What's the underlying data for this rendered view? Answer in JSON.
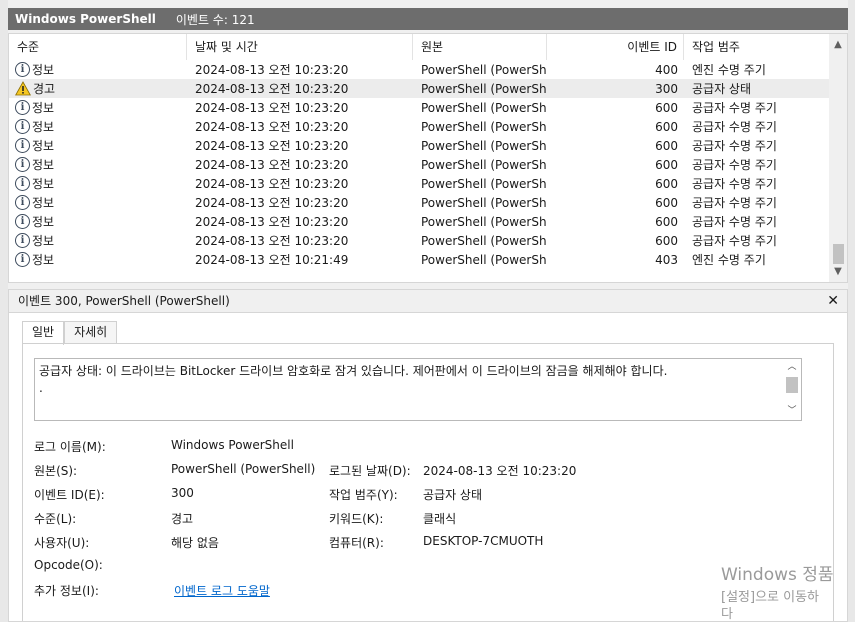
{
  "title_bar": {
    "app_name": "Windows PowerShell",
    "event_count": "이벤트 수: 121"
  },
  "columns": {
    "level": "수준",
    "datetime": "날짜 및 시간",
    "source": "원본",
    "event_id": "이벤트 ID",
    "category": "작업 범주"
  },
  "events": [
    {
      "level": "정보",
      "icon": "info-icon",
      "datetime": "2024-08-13 오전 10:23:20",
      "source": "PowerShell (PowerSh...",
      "event_id": "400",
      "category": "엔진 수명 주기"
    },
    {
      "level": "경고",
      "icon": "warning-icon",
      "datetime": "2024-08-13 오전 10:23:20",
      "source": "PowerShell (PowerSh...",
      "event_id": "300",
      "category": "공급자 상태"
    },
    {
      "level": "정보",
      "icon": "info-icon",
      "datetime": "2024-08-13 오전 10:23:20",
      "source": "PowerShell (PowerSh...",
      "event_id": "600",
      "category": "공급자 수명 주기"
    },
    {
      "level": "정보",
      "icon": "info-icon",
      "datetime": "2024-08-13 오전 10:23:20",
      "source": "PowerShell (PowerSh...",
      "event_id": "600",
      "category": "공급자 수명 주기"
    },
    {
      "level": "정보",
      "icon": "info-icon",
      "datetime": "2024-08-13 오전 10:23:20",
      "source": "PowerShell (PowerSh...",
      "event_id": "600",
      "category": "공급자 수명 주기"
    },
    {
      "level": "정보",
      "icon": "info-icon",
      "datetime": "2024-08-13 오전 10:23:20",
      "source": "PowerShell (PowerSh...",
      "event_id": "600",
      "category": "공급자 수명 주기"
    },
    {
      "level": "정보",
      "icon": "info-icon",
      "datetime": "2024-08-13 오전 10:23:20",
      "source": "PowerShell (PowerSh...",
      "event_id": "600",
      "category": "공급자 수명 주기"
    },
    {
      "level": "정보",
      "icon": "info-icon",
      "datetime": "2024-08-13 오전 10:23:20",
      "source": "PowerShell (PowerSh...",
      "event_id": "600",
      "category": "공급자 수명 주기"
    },
    {
      "level": "정보",
      "icon": "info-icon",
      "datetime": "2024-08-13 오전 10:23:20",
      "source": "PowerShell (PowerSh...",
      "event_id": "600",
      "category": "공급자 수명 주기"
    },
    {
      "level": "정보",
      "icon": "info-icon",
      "datetime": "2024-08-13 오전 10:23:20",
      "source": "PowerShell (PowerSh...",
      "event_id": "600",
      "category": "공급자 수명 주기"
    },
    {
      "level": "정보",
      "icon": "info-icon",
      "datetime": "2024-08-13 오전 10:21:49",
      "source": "PowerShell (PowerSh...",
      "event_id": "403",
      "category": "엔진 수명 주기"
    }
  ],
  "detail": {
    "header": "이벤트 300, PowerShell (PowerShell)",
    "tabs": {
      "general": "일반",
      "details": "자세히"
    },
    "description": "공급자 상태: 이 드라이브는 BitLocker 드라이브 암호화로 잠겨 있습니다. 제어판에서 이 드라이브의 잠금을 해제해야 합니다.",
    "description_cont": ".",
    "fields": {
      "log_name_label": "로그 이름(M):",
      "log_name": "Windows PowerShell",
      "source_label": "원본(S):",
      "source": "PowerShell (PowerShell)",
      "logged_label": "로그된 날짜(D):",
      "logged": "2024-08-13 오전 10:23:20",
      "event_id_label": "이벤트 ID(E):",
      "event_id": "300",
      "task_label": "작업 범주(Y):",
      "task": "공급자 상태",
      "level_label": "수준(L):",
      "level": "경고",
      "keywords_label": "키워드(K):",
      "keywords": "클래식",
      "user_label": "사용자(U):",
      "user": "해당 없음",
      "computer_label": "컴퓨터(R):",
      "computer": "DESKTOP-7CMUOTH",
      "opcode_label": "Opcode(O):",
      "more_info_label": "추가 정보(I):",
      "more_info_link": "이벤트 로그 도움말"
    }
  },
  "watermark": {
    "line1": "Windows 정품",
    "line2": "[설정]으로 이동하",
    "line3": "다"
  }
}
